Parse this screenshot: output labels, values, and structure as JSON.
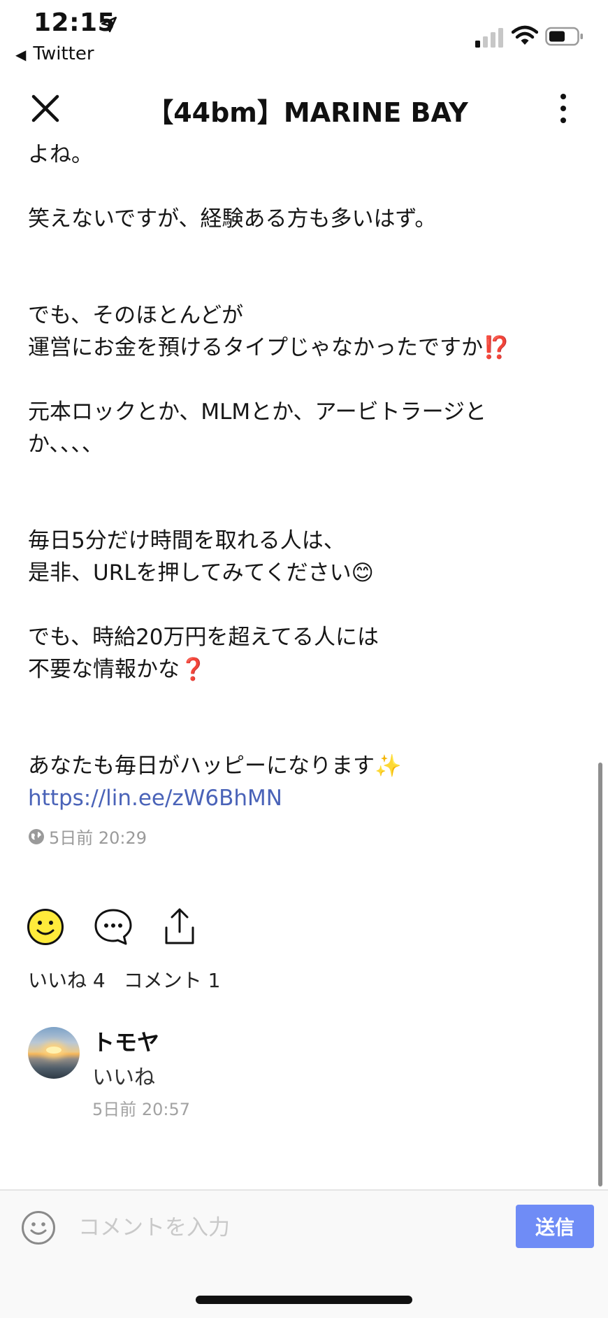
{
  "status_bar": {
    "time": "12:15",
    "back_app": "Twitter"
  },
  "header": {
    "title": "【44bm】MARINE BAY"
  },
  "post": {
    "lines": [
      "よね。",
      "笑えないですが、経験ある方も多いはず。",
      "でも、そのほとんどが",
      "運営にお金を預けるタイプじゃなかったですか",
      "元本ロックとか、MLMとか、アービトラージと",
      "か、、、、",
      "毎日5分だけ時間を取れる人は、",
      "是非、URLを押してみてください",
      "でも、時給20万円を超えてる人には",
      "不要な情報かな",
      "あなたも毎日がハッピーになります"
    ],
    "emojis": {
      "interrobang": "⁉️",
      "smile": "😊",
      "question": "❓",
      "sparkles": "✨"
    },
    "link": "https://lin.ee/zW6BhMN",
    "timestamp": "5日前 20:29"
  },
  "actions": {
    "likes_label": "いいね 4",
    "comments_label": "コメント 1"
  },
  "comment": {
    "author": "トモヤ",
    "text": "いいね",
    "time": "5日前 20:57"
  },
  "input": {
    "placeholder": "コメントを入力",
    "send_label": "送信"
  },
  "colors": {
    "link": "#4a63b8",
    "send_button": "#6f8cf6",
    "meta_text": "#9a9a9a"
  }
}
